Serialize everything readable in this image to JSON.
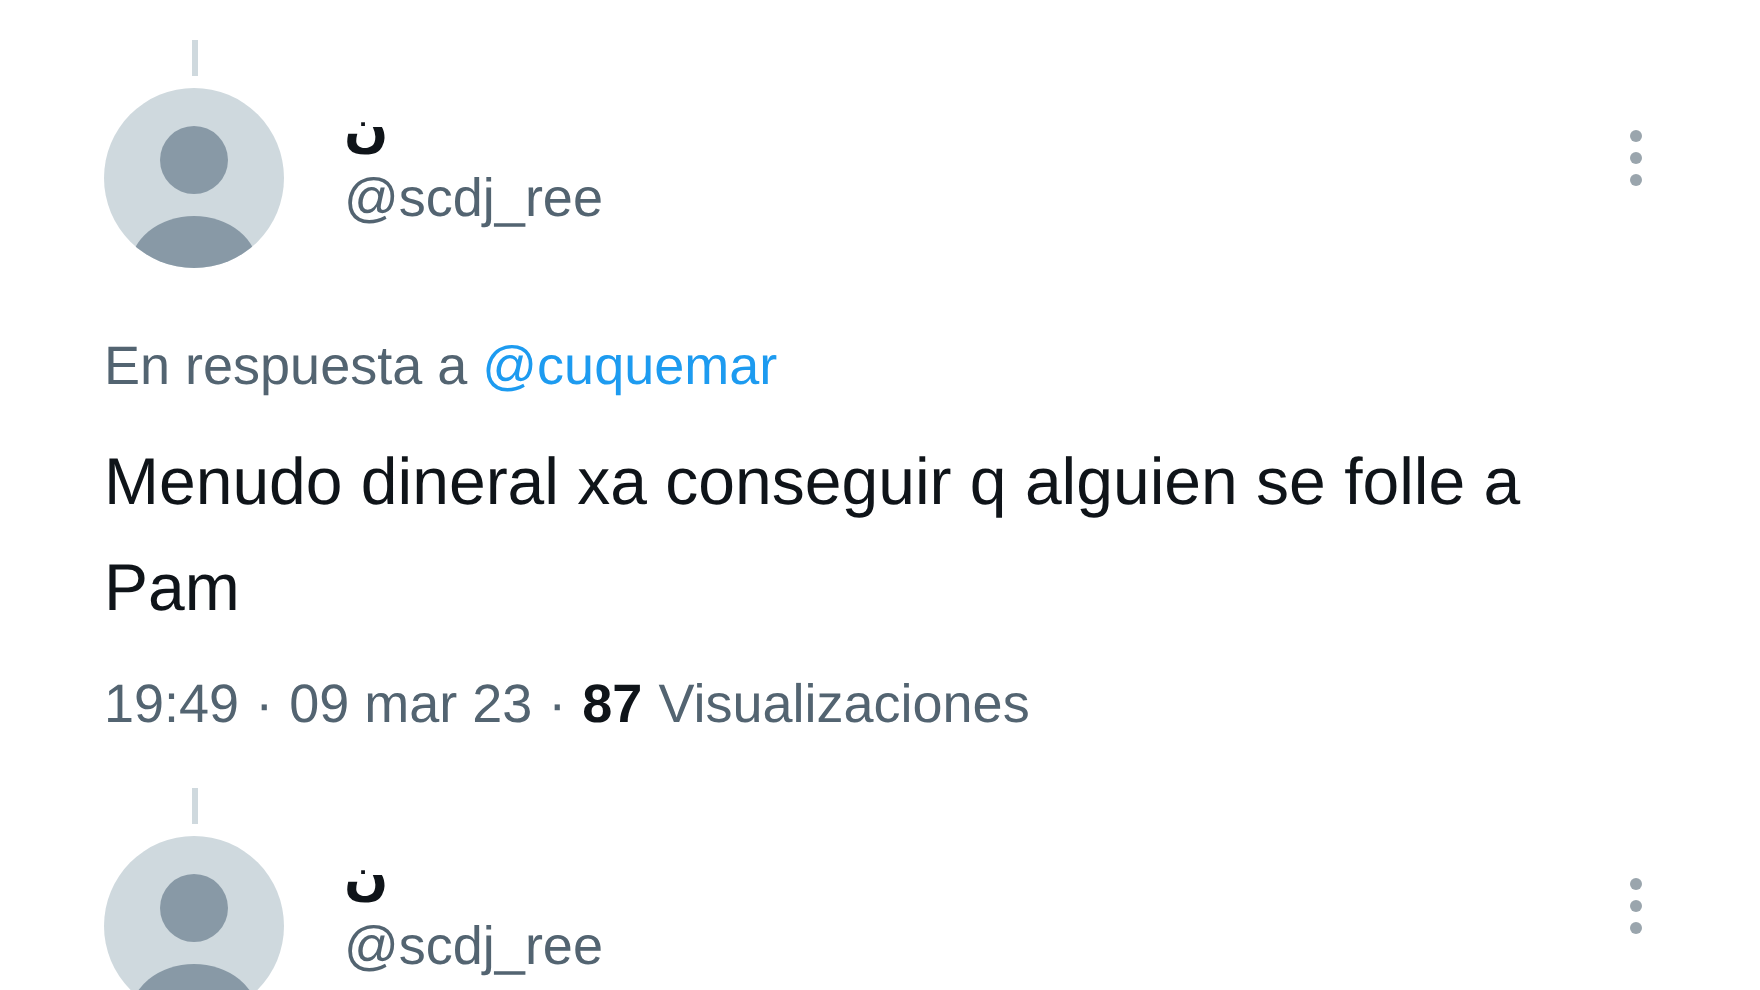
{
  "tweets": [
    {
      "name": "ن",
      "handle": "@scdj_ree",
      "reply_prefix": "En respuesta a",
      "reply_to": "@cuquemar",
      "text": "Menudo dineral xa conseguir q alguien se folle a Pam",
      "meta": [
        {
          "kind": "text",
          "text": "19:49"
        },
        {
          "kind": "text",
          "text": "·"
        },
        {
          "kind": "text",
          "text": "09 mar 23"
        },
        {
          "kind": "text",
          "text": "·"
        },
        {
          "kind": "count",
          "text": "87"
        },
        {
          "kind": "text",
          "text": "Visualizaciones"
        }
      ]
    },
    {
      "name": "ن",
      "handle": "@scdj_ree"
    }
  ]
}
